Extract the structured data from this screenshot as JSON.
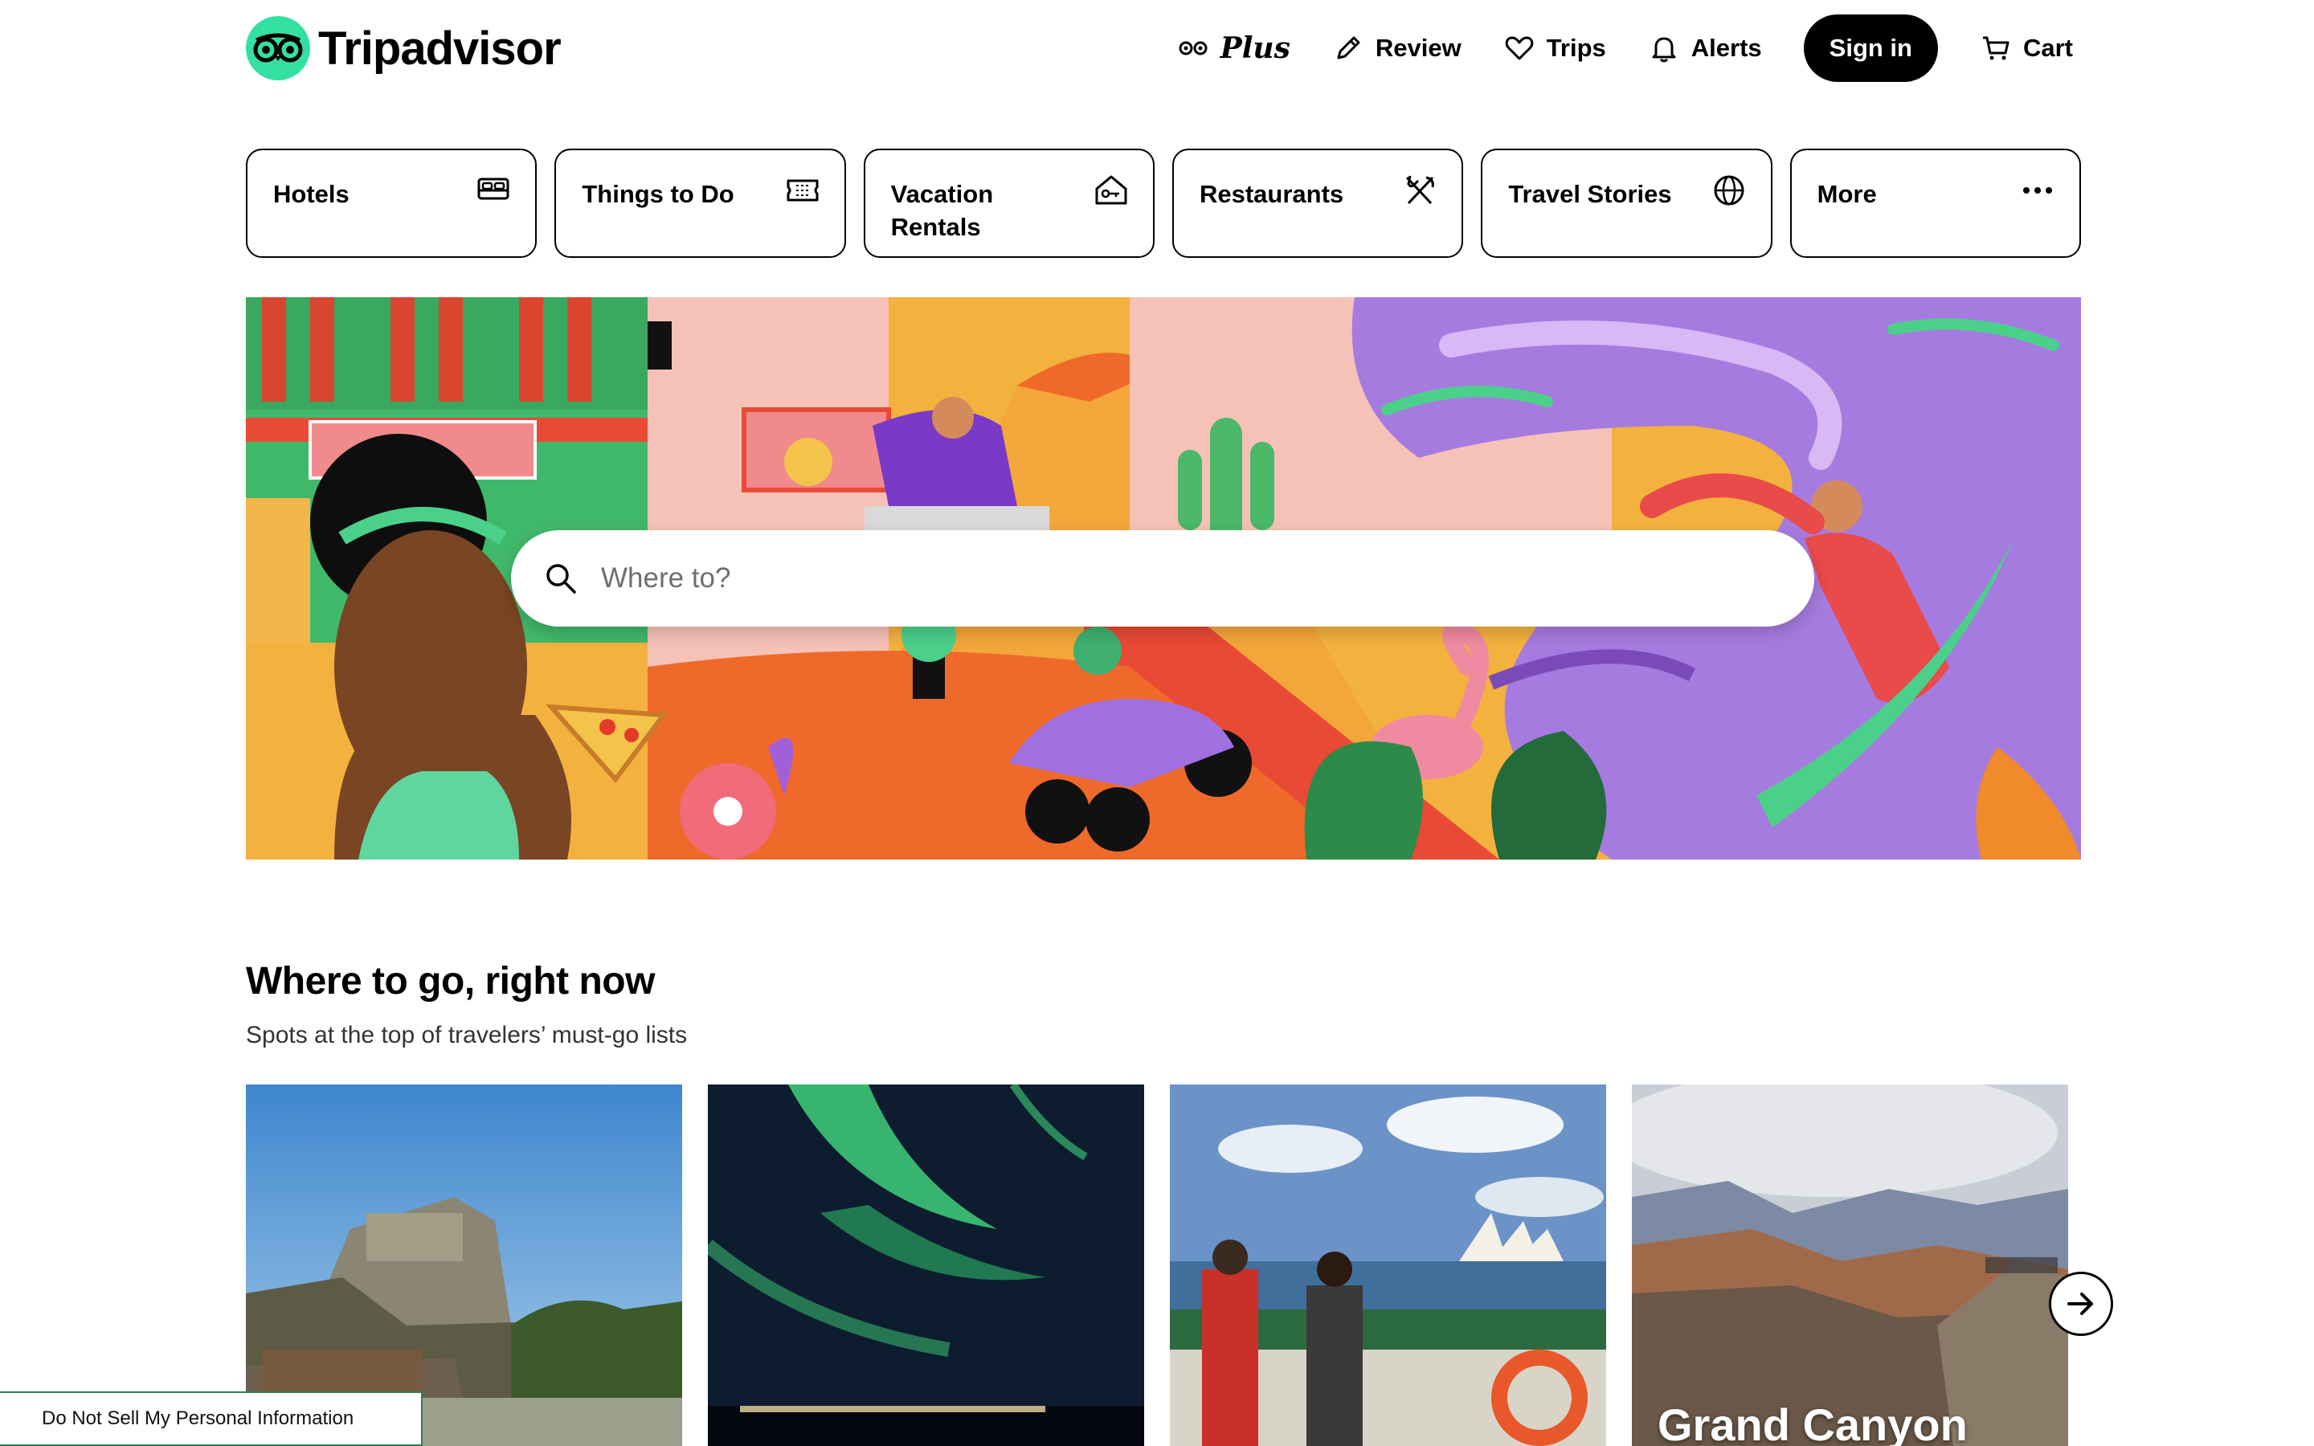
{
  "header": {
    "brand": "Tripadvisor",
    "logo_icon": "owl-logo-icon",
    "nav": {
      "plus_label": "Plus",
      "review_label": "Review",
      "trips_label": "Trips",
      "alerts_label": "Alerts",
      "signin_label": "Sign in",
      "cart_label": "Cart"
    }
  },
  "tabs": [
    {
      "label": "Hotels",
      "icon": "bed-icon"
    },
    {
      "label": "Things to Do",
      "icon": "ticket-icon"
    },
    {
      "label": "Vacation Rentals",
      "icon": "house-key-icon"
    },
    {
      "label": "Restaurants",
      "icon": "utensils-icon"
    },
    {
      "label": "Travel Stories",
      "icon": "globe-icon"
    },
    {
      "label": "More",
      "icon": "ellipsis-icon"
    }
  ],
  "search": {
    "placeholder": "Where to?",
    "value": ""
  },
  "section": {
    "title": "Where to go, right now",
    "subtitle": "Spots at the top of travelers’ must-go lists"
  },
  "cards": [
    {
      "label": ""
    },
    {
      "label": ""
    },
    {
      "label": ""
    },
    {
      "label": "Grand Canyon"
    }
  ],
  "footer_link": "Do Not Sell My Personal Information",
  "colors": {
    "brand_green": "#34e0a1",
    "black": "#000000"
  }
}
